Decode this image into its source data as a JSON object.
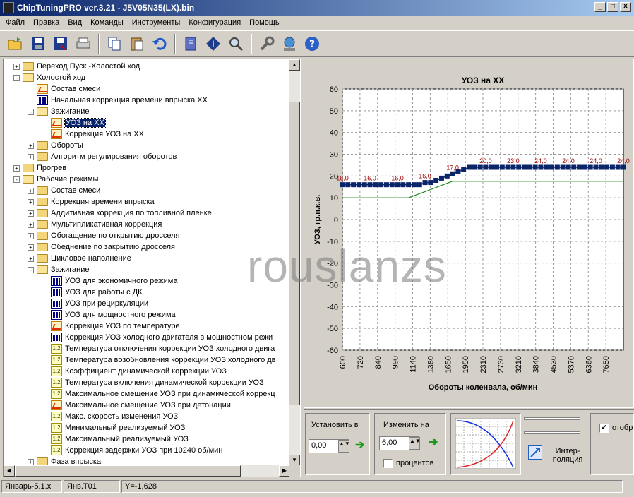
{
  "window": {
    "title": "ChipTuningPRO ver.3.21 - J5V05N35(LX).bin",
    "min": "_",
    "max": "□",
    "close": "X"
  },
  "menu": [
    "Файл",
    "Правка",
    "Вид",
    "Команды",
    "Инструменты",
    "Конфигурация",
    "Помощь"
  ],
  "tree": [
    {
      "label": "Переход Пуск -Холостой ход",
      "level": 1,
      "icon": "folder",
      "exp": "+"
    },
    {
      "label": "Холостой ход",
      "level": 1,
      "icon": "openfolder",
      "exp": "-"
    },
    {
      "label": "Состав смеси",
      "level": 2,
      "icon": "map",
      "exp": ""
    },
    {
      "label": "Начальная коррекция времени впрыска ХХ",
      "level": 2,
      "icon": "bars",
      "exp": ""
    },
    {
      "label": "Зажигание",
      "level": 2,
      "icon": "openfolder",
      "exp": "-"
    },
    {
      "label": "УОЗ на ХХ",
      "level": 3,
      "icon": "map",
      "exp": "",
      "selected": true
    },
    {
      "label": "Коррекция УОЗ на ХХ",
      "level": 3,
      "icon": "map",
      "exp": ""
    },
    {
      "label": "Обороты",
      "level": 2,
      "icon": "folder",
      "exp": "+"
    },
    {
      "label": "Алгоритм регулирования оборотов",
      "level": 2,
      "icon": "folder",
      "exp": "+"
    },
    {
      "label": "Прогрев",
      "level": 1,
      "icon": "folder",
      "exp": "+"
    },
    {
      "label": "Рабочие режимы",
      "level": 1,
      "icon": "openfolder",
      "exp": "-"
    },
    {
      "label": "Состав смеси",
      "level": 2,
      "icon": "folder",
      "exp": "+"
    },
    {
      "label": "Коррекция времени впрыска",
      "level": 2,
      "icon": "folder",
      "exp": "+"
    },
    {
      "label": "Аддитивная коррекция по топливной пленке",
      "level": 2,
      "icon": "folder",
      "exp": "+"
    },
    {
      "label": "Мультипликативная коррекция",
      "level": 2,
      "icon": "folder",
      "exp": "+"
    },
    {
      "label": "Обогащение по открытию дросселя",
      "level": 2,
      "icon": "folder",
      "exp": "+"
    },
    {
      "label": "Обеднение по закрытию дросселя",
      "level": 2,
      "icon": "folder",
      "exp": "+"
    },
    {
      "label": "Цикловое наполнение",
      "level": 2,
      "icon": "folder",
      "exp": "+"
    },
    {
      "label": "Зажигание",
      "level": 2,
      "icon": "openfolder",
      "exp": "-"
    },
    {
      "label": "УОЗ для экономичного режима",
      "level": 3,
      "icon": "bars",
      "exp": ""
    },
    {
      "label": "УОЗ для работы с ДК",
      "level": 3,
      "icon": "bars",
      "exp": ""
    },
    {
      "label": "УОЗ при рециркуляции",
      "level": 3,
      "icon": "bars",
      "exp": ""
    },
    {
      "label": "УОЗ для мощностного режима",
      "level": 3,
      "icon": "bars",
      "exp": ""
    },
    {
      "label": "Коррекция УОЗ по температуре",
      "level": 3,
      "icon": "map",
      "exp": ""
    },
    {
      "label": "Коррекция УОЗ холодного двигателя в мощностном режи",
      "level": 3,
      "icon": "bars",
      "exp": ""
    },
    {
      "label": "Температура отключения коррекции УОЗ холодного двига",
      "level": 3,
      "icon": "num",
      "exp": ""
    },
    {
      "label": "Температура возобновления коррекции УОЗ холодного дв",
      "level": 3,
      "icon": "num",
      "exp": ""
    },
    {
      "label": "Коэффициент динамической коррекции УОЗ",
      "level": 3,
      "icon": "num",
      "exp": ""
    },
    {
      "label": "Температура включения динамической коррекции УОЗ",
      "level": 3,
      "icon": "num",
      "exp": ""
    },
    {
      "label": "Максимальное смещение УОЗ при динамической коррекц",
      "level": 3,
      "icon": "num",
      "exp": ""
    },
    {
      "label": "Максимальное смещение УОЗ при детонации",
      "level": 3,
      "icon": "map",
      "exp": ""
    },
    {
      "label": "Макс. скорость изменения УОЗ",
      "level": 3,
      "icon": "num",
      "exp": ""
    },
    {
      "label": "Минимальный реализуемый УОЗ",
      "level": 3,
      "icon": "num",
      "exp": ""
    },
    {
      "label": "Максимальный реализуемый УОЗ",
      "level": 3,
      "icon": "num",
      "exp": ""
    },
    {
      "label": "Коррекция задержки УОЗ при 10240 об/мин",
      "level": 3,
      "icon": "num",
      "exp": ""
    },
    {
      "label": "Фаза впрыска",
      "level": 2,
      "icon": "folder",
      "exp": "+"
    }
  ],
  "chart_data": {
    "type": "line",
    "title": "УОЗ на ХХ",
    "xlabel": "Обороты коленвала, об/мин",
    "ylabel": "УОЗ, гр.п.к.в.",
    "ylim": [
      -60,
      60
    ],
    "yticks": [
      60,
      50,
      40,
      30,
      20,
      10,
      0,
      -10,
      -20,
      -30,
      -40,
      -50,
      -60
    ],
    "categories": [
      "600",
      "720",
      "840",
      "990",
      "1140",
      "1380",
      "1650",
      "1950",
      "2310",
      "2730",
      "3210",
      "3840",
      "4530",
      "5370",
      "6360",
      "7650"
    ],
    "series": [
      {
        "values": [
          16,
          16,
          16,
          16,
          16,
          16,
          16,
          16,
          16,
          16,
          16,
          16,
          16,
          16,
          16,
          17,
          17,
          18,
          19,
          20,
          21,
          22,
          23,
          24,
          24,
          24,
          24,
          24,
          24,
          24,
          24,
          24,
          24,
          24,
          24,
          24,
          24,
          24,
          24,
          24,
          24,
          24,
          24,
          24,
          24,
          24,
          24,
          24,
          24,
          24,
          24,
          24
        ]
      },
      {
        "values": [
          10,
          10,
          10,
          10,
          10,
          10,
          10,
          10,
          10,
          10,
          10,
          10,
          10,
          10,
          10,
          10,
          10,
          10,
          10,
          10,
          10,
          10,
          10,
          10,
          10,
          10,
          10,
          10,
          10,
          10,
          10,
          10,
          10,
          10,
          10,
          10,
          10,
          10,
          10,
          10,
          10,
          10,
          10,
          10,
          10,
          10,
          10,
          10,
          10,
          10,
          10,
          10
        ]
      }
    ],
    "point_labels": [
      {
        "index": 0,
        "text": "16,0"
      },
      {
        "index": 3,
        "text": "16,0"
      },
      {
        "index": 6,
        "text": "16,0"
      },
      {
        "index": 9,
        "text": "16,0"
      },
      {
        "index": 12,
        "text": "17,0"
      },
      {
        "index": 15,
        "text": "20,0"
      },
      {
        "index": 18,
        "text": "23,0"
      },
      {
        "index": 21,
        "text": "24,0"
      },
      {
        "index": 24,
        "text": "24,0"
      },
      {
        "index": 27,
        "text": "24,0"
      },
      {
        "index": 30,
        "text": "24,0"
      }
    ],
    "grid": true,
    "colors": {
      "main": "#0a246a",
      "secondary": "#1a8a1a",
      "label": "#a00000"
    }
  },
  "controls": {
    "set_label": "Установить в",
    "set_value": "0,00",
    "change_label": "Изменить на",
    "change_value": "6,00",
    "percent_label": "процентов",
    "interp_label": "Интер-поляция",
    "display_label": "отобр"
  },
  "status": [
    "Январь-5.1.x",
    "Янв.Т01",
    "Y=-1,628"
  ],
  "watermark": "rouslanzs"
}
